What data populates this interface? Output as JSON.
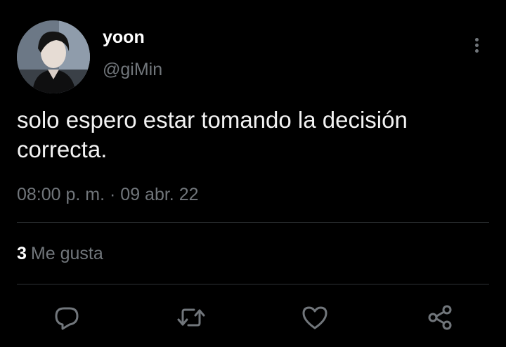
{
  "user": {
    "display_name": "yoon",
    "handle": "@giMin"
  },
  "tweet": {
    "text": "solo espero estar tomando la decisión correcta.",
    "timestamp": "08:00 p. m. · 09 abr. 22"
  },
  "stats": {
    "likes_count": "3",
    "likes_label": "Me gusta"
  },
  "actions": {
    "reply_icon": "reply-icon",
    "retweet_icon": "retweet-icon",
    "like_icon": "heart-icon",
    "share_icon": "share-icon"
  },
  "colors": {
    "background": "#000000",
    "primary_text": "#e7e9ea",
    "secondary_text": "#71767b",
    "divider": "#2f3336"
  }
}
